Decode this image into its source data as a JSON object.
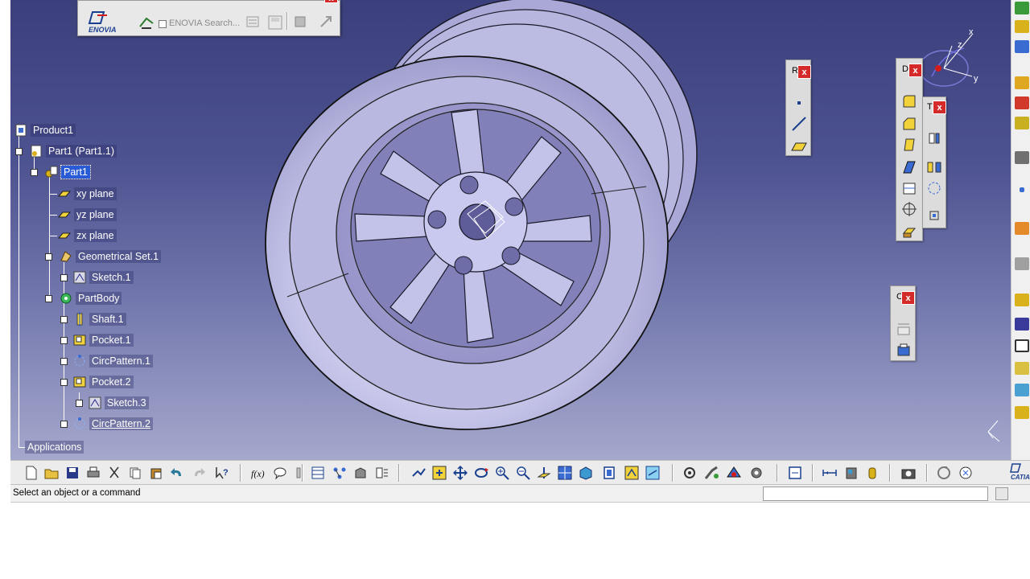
{
  "tree": {
    "root": "Product1",
    "items": [
      {
        "label": "Part1 (Part1.1)",
        "icon": "part-instance-icon"
      },
      {
        "label": "Part1",
        "icon": "part-icon",
        "selected": true
      },
      {
        "label": "xy plane",
        "icon": "plane-icon"
      },
      {
        "label": "yz plane",
        "icon": "plane-icon"
      },
      {
        "label": "zx plane",
        "icon": "plane-icon"
      },
      {
        "label": "Geometrical Set.1",
        "icon": "geometrical-set-icon"
      },
      {
        "label": "Sketch.1",
        "icon": "sketch-icon"
      },
      {
        "label": "PartBody",
        "icon": "partbody-icon"
      },
      {
        "label": "Shaft.1",
        "icon": "shaft-icon"
      },
      {
        "label": "Pocket.1",
        "icon": "pocket-icon"
      },
      {
        "label": "CircPattern.1",
        "icon": "circpattern-icon"
      },
      {
        "label": "Pocket.2",
        "icon": "pocket-icon"
      },
      {
        "label": "Sketch.3",
        "icon": "sketch-icon"
      },
      {
        "label": "CircPattern.2",
        "icon": "circpattern-icon",
        "underlined": true
      }
    ],
    "applications": "Applications"
  },
  "enovia": {
    "logo_text": "ENOVIA",
    "search_placeholder": "ENOVIA Search..."
  },
  "floating_toolbars": {
    "ref_title": "R",
    "dress_title": "D",
    "transform_title": "T",
    "constraint_title": "C",
    "close_glyph": "x"
  },
  "compass": {
    "x_label": "x",
    "y_label": "y",
    "z_label": "z"
  },
  "status": {
    "message": "Select an object or a command",
    "command_value": ""
  },
  "brand": {
    "catia_label": "CATIA"
  },
  "colors": {
    "viewport_top": "#3b3f7c",
    "viewport_bottom": "#a5a8cc",
    "selection": "#2a5bd7",
    "close_button": "#d42a2a",
    "model_fill": "#c9c8ea"
  }
}
